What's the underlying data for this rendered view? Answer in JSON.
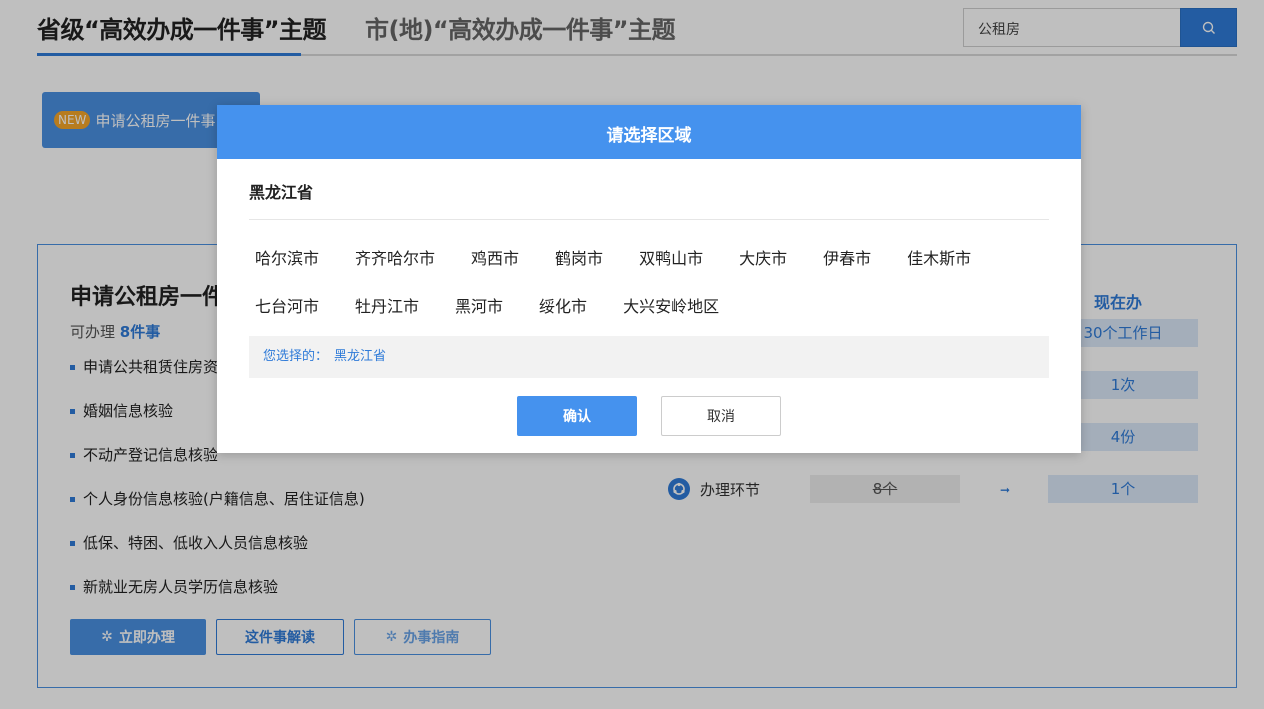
{
  "header": {
    "tabs": [
      {
        "label": "省级“高效办成一件事”主题"
      },
      {
        "label": "市(地)“高效办成一件事”主题"
      }
    ],
    "search": {
      "value": "公租房"
    }
  },
  "feature": {
    "badge": "NEW",
    "label": "申请公租房一件事"
  },
  "card": {
    "title": "申请公租房一件事",
    "count_prefix": "可办理",
    "count": "8件事",
    "items": [
      "申请公共租赁住房资格",
      "婚姻信息核验",
      "不动产登记信息核验",
      "个人身份信息核验(户籍信息、居住证信息)",
      "低保、特困、低收入人员信息核验",
      "新就业无房人员学历信息核验"
    ],
    "buttons": {
      "apply": "立即办理",
      "explain": "这件事解读",
      "guide": "办事指南"
    },
    "compare": {
      "now_label": "现在办",
      "rows": [
        {
          "label": "",
          "old": "",
          "new": "30个工作日"
        },
        {
          "label": "",
          "old": "",
          "new": "1次"
        },
        {
          "label": "",
          "old": "",
          "new": "4份"
        },
        {
          "label": "办理环节",
          "old": "8个",
          "new": "1个"
        }
      ]
    }
  },
  "modal": {
    "title": "请选择区域",
    "province": "黑龙江省",
    "cities_row1": [
      "哈尔滨市",
      "齐齐哈尔市",
      "鸡西市",
      "鹤岗市",
      "双鸭山市",
      "大庆市",
      "伊春市",
      "佳木斯市"
    ],
    "cities_row2": [
      "七台河市",
      "牡丹江市",
      "黑河市",
      "绥化市",
      "大兴安岭地区"
    ],
    "selection_label": "您选择的：",
    "selection_value": "黑龙江省",
    "confirm": "确认",
    "cancel": "取消"
  },
  "colors": {
    "accent": "#2f7bd8",
    "modal_header": "#4592ee",
    "badge": "#f4a62a"
  }
}
